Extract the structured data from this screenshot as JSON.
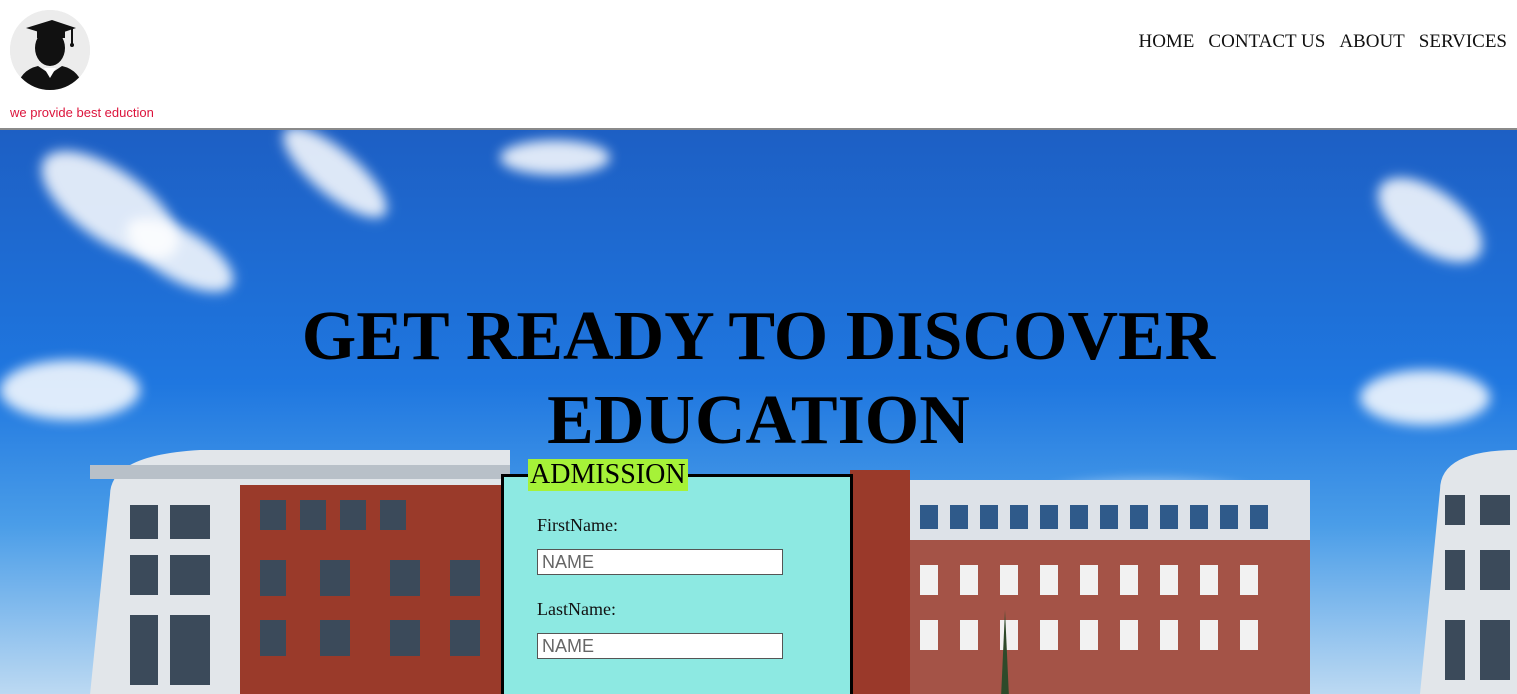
{
  "header": {
    "tagline": "we provide best eduction",
    "nav": [
      {
        "label": "HOME"
      },
      {
        "label": "CONTACT US"
      },
      {
        "label": "ABOUT"
      },
      {
        "label": "SERVICES"
      }
    ]
  },
  "hero": {
    "title_line1": "GET READY TO DISCOVER",
    "title_line2": "EDUCATION"
  },
  "form": {
    "legend": "ADMISSION",
    "first_name_label": "FirstName:",
    "first_name_placeholder": "NAME",
    "last_name_label": "LastName:",
    "last_name_placeholder": "NAME"
  },
  "colors": {
    "tagline": "#dc143c",
    "form_bg": "#8de9e2",
    "legend_bg": "#a6f238"
  }
}
